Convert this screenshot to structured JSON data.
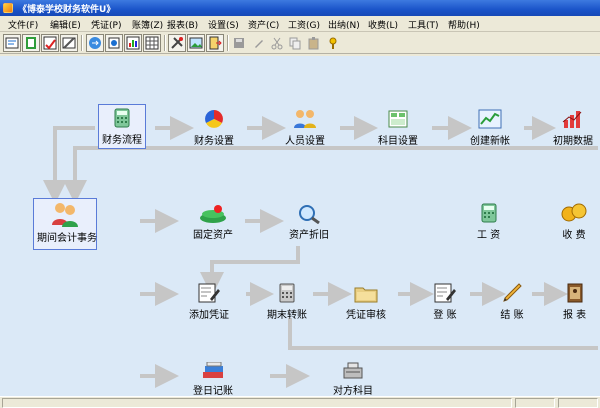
{
  "window": {
    "title": "《博泰学校财务软件U》"
  },
  "menu": [
    {
      "label": "文件(F)"
    },
    {
      "label": "编辑(E)"
    },
    {
      "label": "凭证(P)"
    },
    {
      "label": "账簿(Z)"
    },
    {
      "label": "报表(B)"
    },
    {
      "label": "设置(S)"
    },
    {
      "label": "资产(C)"
    },
    {
      "label": "工资(G)"
    },
    {
      "label": "出纳(N)"
    },
    {
      "label": "收费(L)"
    },
    {
      "label": "工具(T)"
    },
    {
      "label": "帮助(H)"
    }
  ],
  "flow": {
    "caiwu_liucheng": "财务流程",
    "caiwu_shezhi": "财务设置",
    "renyuan_shezhi": "人员设置",
    "kemu_shezhi": "科目设置",
    "chuangjian_xinzhang": "创建新帐",
    "chuqi_shuju": "初期数据",
    "qijian_kuaiji": "期间会计事务",
    "guding_zichan": "固定资产",
    "zichan_zhejiu": "资产折旧",
    "gongzi": "工 资",
    "shoufei": "收 费",
    "tianjia_pingzheng": "添加凭证",
    "qimo_zhuanzhang": "期末转账",
    "pingzheng_shenhe": "凭证审核",
    "dengzhang": "登 账",
    "jiezhang": "结 账",
    "baobiao": "报 表",
    "rijizhang": "登日记账",
    "duifang_kemu": "对方科目"
  },
  "colors": {
    "workspace": "#dbe9f7",
    "arrow": "#c6c6c6",
    "title": "#1a54c9"
  }
}
